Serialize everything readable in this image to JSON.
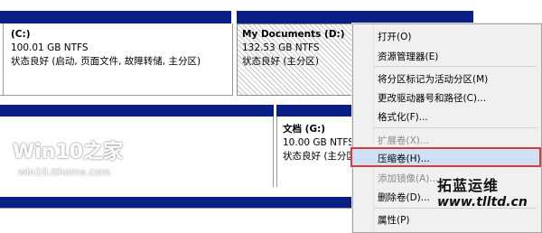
{
  "partitions": {
    "c": {
      "title": "(C:)",
      "size": "100.01 GB NTFS",
      "status": "状态良好 (启动, 页面文件, 故障转储, 主分区)"
    },
    "d": {
      "title": "My Documents  (D:)",
      "size": "132.53 GB NTFS",
      "status": "状态良好 (主分区)"
    },
    "g": {
      "title": "文档  (G:)",
      "size": "10.00 GB NTFS",
      "status": "状态良好 (主分区)"
    }
  },
  "context_menu": {
    "items": [
      {
        "label": "打开(O)",
        "enabled": true
      },
      {
        "label": "资源管理器(E)",
        "enabled": true
      },
      {
        "label": "将分区标记为活动分区(M)",
        "enabled": true
      },
      {
        "label": "更改驱动器号和路径(C)...",
        "enabled": true
      },
      {
        "label": "格式化(F)...",
        "enabled": true
      },
      {
        "label": "扩展卷(X)...",
        "enabled": false
      },
      {
        "label": "压缩卷(H)...",
        "enabled": true,
        "highlighted": true
      },
      {
        "label": "添加镜像(A)...",
        "enabled": false
      },
      {
        "label": "删除卷(D)...",
        "enabled": true
      },
      {
        "label": "属性(P)",
        "enabled": true
      }
    ]
  },
  "watermark": {
    "title": "Win10之家",
    "url": "win10.ithome.com"
  },
  "brand": {
    "name": "拓蓝运维",
    "url": "www.tlltd.cn"
  },
  "colors": {
    "partition_bar": "#0a1f86",
    "highlight_border": "#d93b3b",
    "highlight_fill": "#cfe0f4"
  }
}
